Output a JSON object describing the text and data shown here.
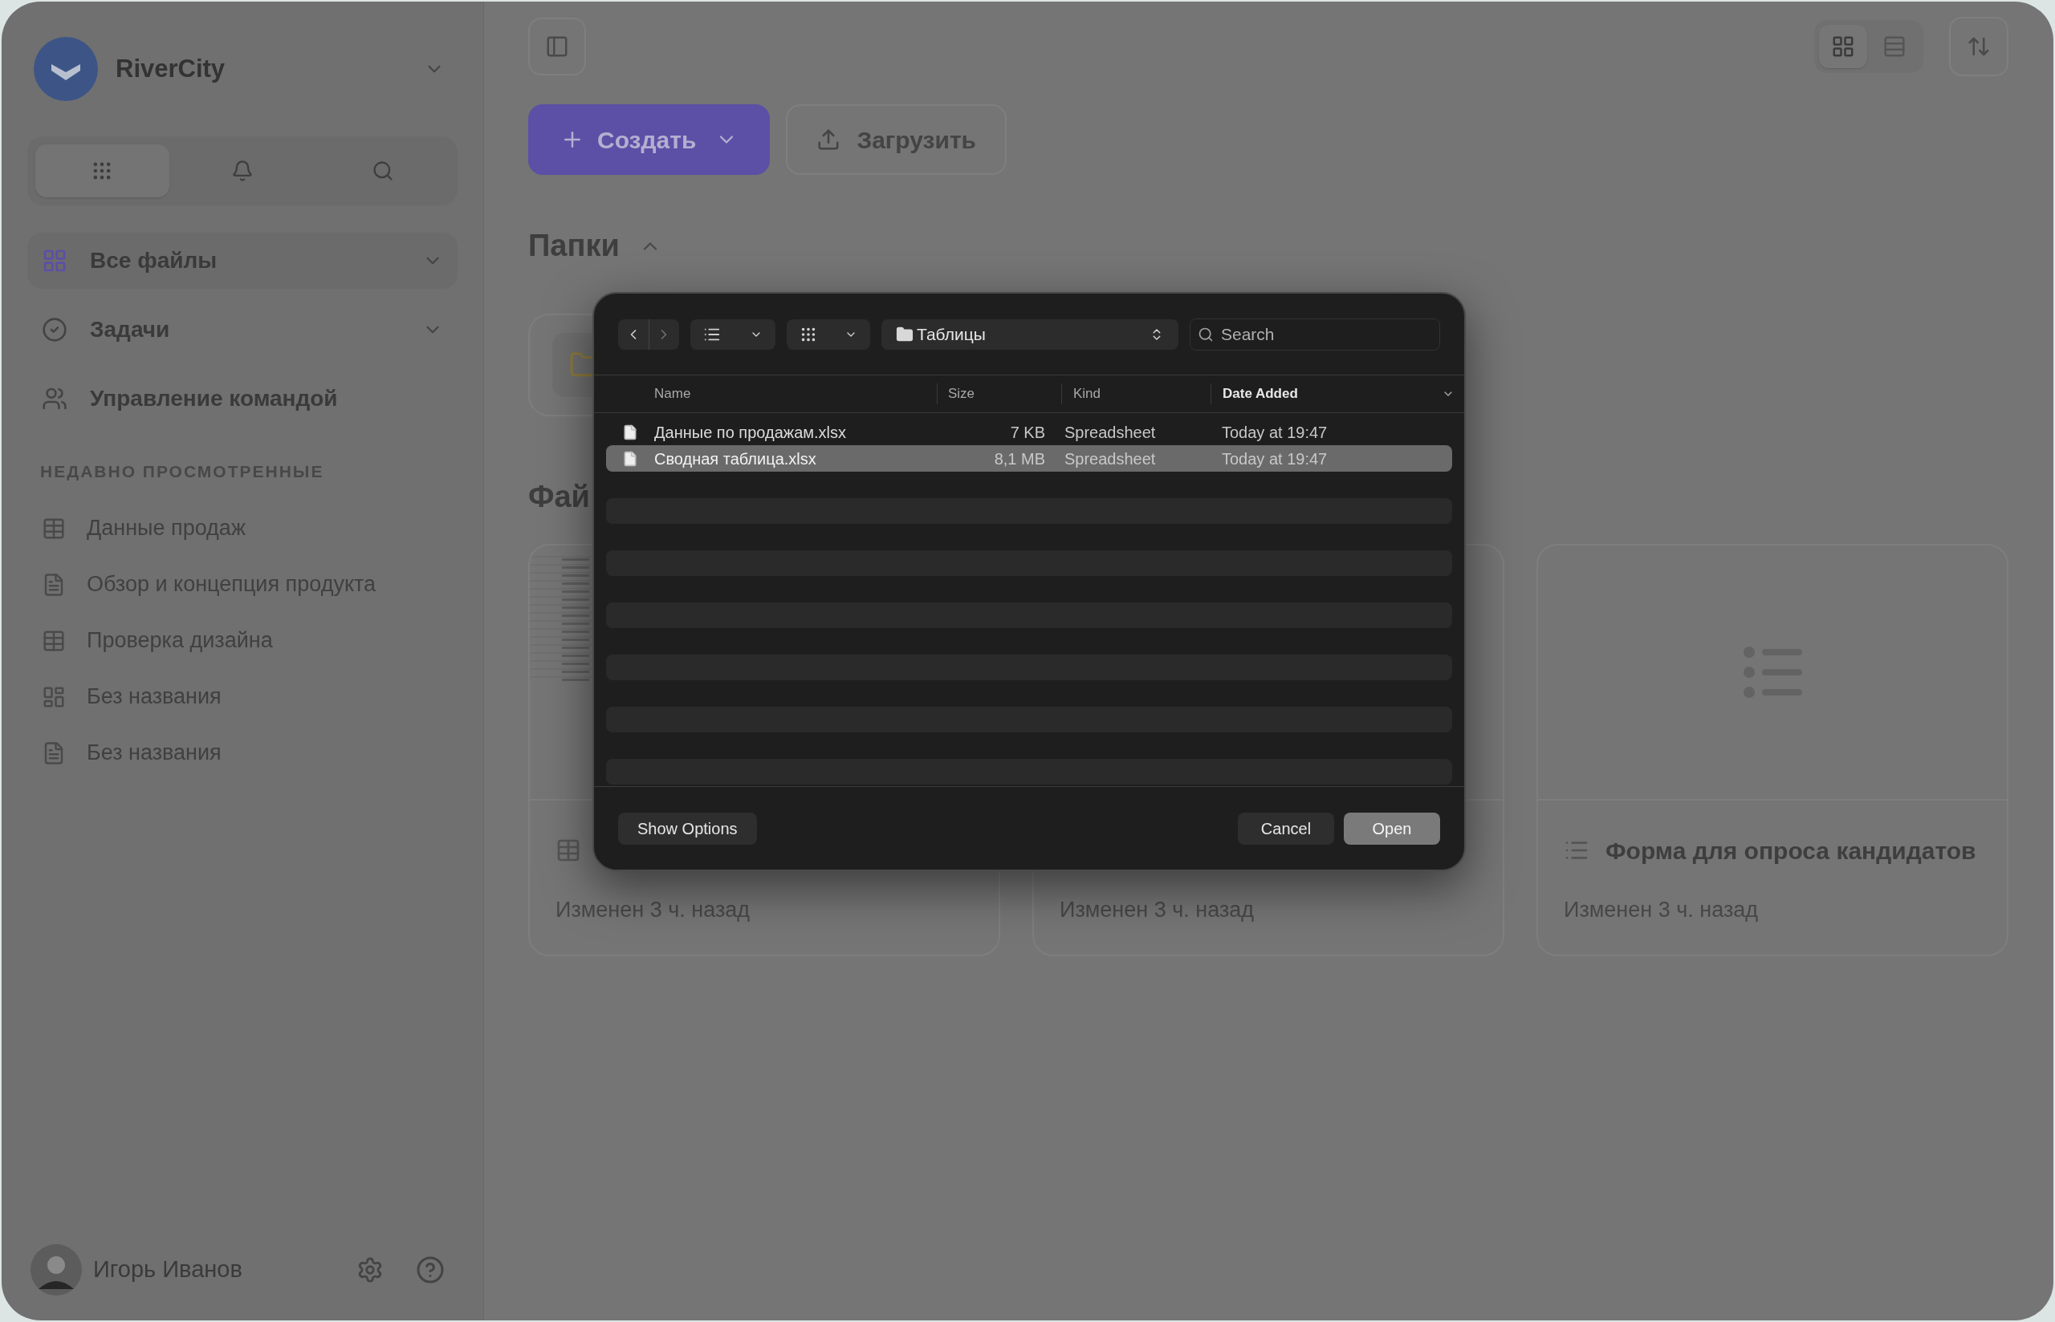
{
  "sidebar": {
    "workspace": "RiverCity",
    "tools": [
      {
        "kind": "apps",
        "selected": true
      },
      {
        "kind": "bell",
        "selected": false
      },
      {
        "kind": "search",
        "selected": false
      }
    ],
    "nav": [
      {
        "label": "Все файлы",
        "kind": "files",
        "selected": true,
        "expandable": true
      },
      {
        "label": "Задачи",
        "kind": "tasks",
        "selected": false,
        "expandable": true
      },
      {
        "label": "Управление командой",
        "kind": "team",
        "selected": false,
        "expandable": false
      }
    ],
    "recent_heading": "НЕДАВНО ПРОСМОТРЕННЫЕ",
    "recent": [
      {
        "label": "Данные продаж",
        "kind": "table"
      },
      {
        "label": "Обзор и концепция продукта",
        "kind": "doc"
      },
      {
        "label": "Проверка дизайна",
        "kind": "table"
      },
      {
        "label": "Без названия",
        "kind": "board"
      },
      {
        "label": "Без названия",
        "kind": "doc"
      }
    ],
    "user": {
      "name": "Игорь Иванов"
    }
  },
  "toolbar": {
    "create": "Создать",
    "upload": "Загрузить",
    "views": [
      {
        "kind": "grid",
        "selected": true
      },
      {
        "kind": "list",
        "selected": false
      }
    ]
  },
  "folders": {
    "title": "Папки",
    "expanded": true
  },
  "files": {
    "title": "Фай",
    "cards": [
      {
        "kind": "table",
        "modified": "Изменен 3 ч. назад"
      },
      {
        "modified": "Изменен 3 ч. назад"
      },
      {
        "kind": "form",
        "title": "Форма для опроса кандидатов",
        "modified": "Изменен 3 ч. назад"
      }
    ]
  },
  "dialog": {
    "path": "Таблицы",
    "search_placeholder": "Search",
    "columns": [
      {
        "label": "Name",
        "sorted": false
      },
      {
        "label": "Size",
        "sorted": false
      },
      {
        "label": "Kind",
        "sorted": false
      },
      {
        "label": "Date Added",
        "sorted": true
      }
    ],
    "rows": [
      {
        "name": "Данные по продажам.xlsx",
        "size": "7 KB",
        "kind": "Spreadsheet",
        "date": "Today at 19:47",
        "selected": false
      },
      {
        "name": "Сводная таблица.xlsx",
        "size": "8,1 MB",
        "kind": "Spreadsheet",
        "date": "Today at 19:47",
        "selected": true
      }
    ],
    "options": "Show Options",
    "cancel": "Cancel",
    "open": "Open"
  }
}
